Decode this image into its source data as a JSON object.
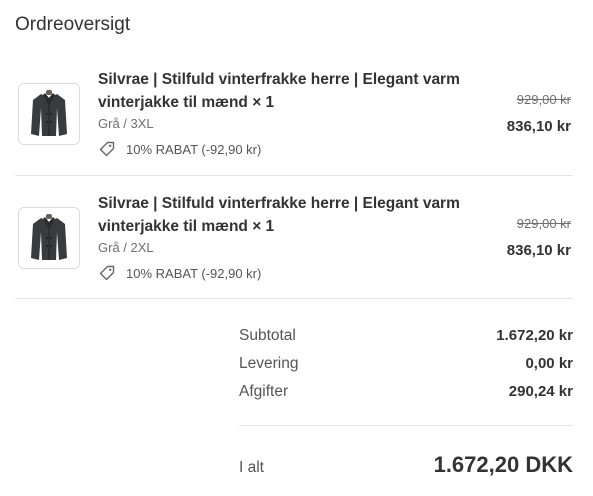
{
  "header": {
    "title": "Ordreoversigt"
  },
  "items": [
    {
      "name": "Silvrae | Stilfuld vinterfrakke herre | Elegant varm vinterjakke til mænd × 1",
      "variant": "Grå / 3XL",
      "discount": "10% RABAT (-92,90 kr)",
      "original_price": "929,00 kr",
      "final_price": "836,10 kr",
      "image_icon": "coat-image"
    },
    {
      "name": "Silvrae | Stilfuld vinterfrakke herre | Elegant varm vinterjakke til mænd × 1",
      "variant": "Grå / 2XL",
      "discount": "10% RABAT (-92,90 kr)",
      "original_price": "929,00 kr",
      "final_price": "836,10 kr",
      "image_icon": "coat-image"
    }
  ],
  "summary": {
    "subtotal_label": "Subtotal",
    "subtotal_value": "1.672,20 kr",
    "shipping_label": "Levering",
    "shipping_value": "0,00 kr",
    "taxes_label": "Afgifter",
    "taxes_value": "290,24 kr",
    "total_label": "I alt",
    "total_value": "1.672,20 DKK"
  },
  "icons": {
    "discount": "tag-icon"
  },
  "colors": {
    "text": "#333333",
    "muted": "#707070",
    "divider": "#e6e6e6"
  }
}
